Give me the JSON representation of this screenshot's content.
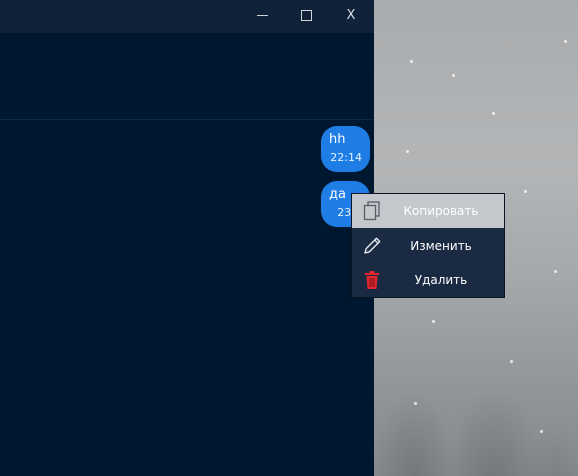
{
  "window": {
    "controls": {
      "close_label": "X"
    }
  },
  "messages": [
    {
      "text": "hh",
      "time": "22:14"
    },
    {
      "text": "да",
      "time": "23:1"
    }
  ],
  "context_menu": {
    "items": [
      {
        "label": "Копировать",
        "icon": "copy-icon",
        "highlighted": true
      },
      {
        "label": "Изменить",
        "icon": "pencil-icon"
      },
      {
        "label": "Удалить",
        "icon": "trash-icon",
        "icon_color": "#e0282e"
      }
    ]
  },
  "colors": {
    "window_bg": "#001730",
    "titlebar_bg": "#10223a",
    "bubble_bg": "#1f7ee6",
    "menu_bg": "#1a2a43",
    "menu_highlight": "#c4c7cb"
  }
}
